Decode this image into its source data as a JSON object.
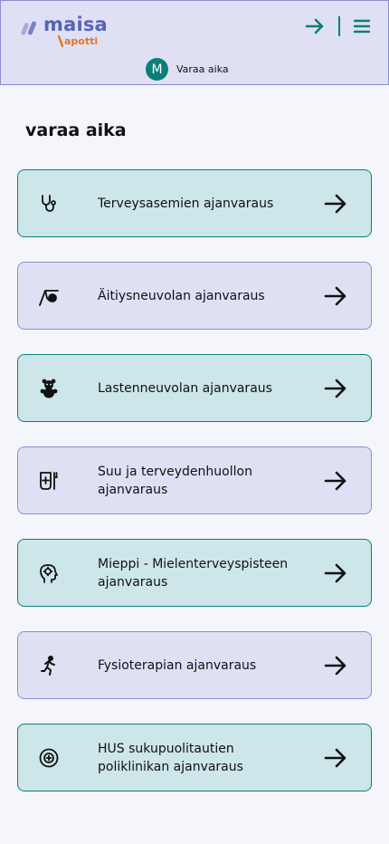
{
  "header": {
    "logo_text": "maisa",
    "logo_subtext": "apotti",
    "login_icon": "login-arrow-icon",
    "menu_icon": "hamburger-menu-icon",
    "user": {
      "initial": "M",
      "label": "Varaa aika"
    }
  },
  "colors": {
    "teal": "#0a7f7a",
    "lavender": "#5a63b8",
    "orange": "#e8731f"
  },
  "page": {
    "title": "varaa aika"
  },
  "cards": [
    {
      "label": "Terveysasemien ajanvaraus",
      "icon": "stethoscope-icon",
      "variant": "teal"
    },
    {
      "label": "Äitiysneuvolan ajanvaraus",
      "icon": "stork-baby-icon",
      "variant": "lavender"
    },
    {
      "label": "Lastenneuvolan ajanvaraus",
      "icon": "teddy-bear-icon",
      "variant": "teal"
    },
    {
      "label": "Suu ja terveydenhuollon ajanvaraus",
      "icon": "toothpaste-brush-icon",
      "variant": "lavender"
    },
    {
      "label": "Mieppi - Mielenterveyspisteen ajanvaraus",
      "icon": "head-brain-icon",
      "variant": "teal"
    },
    {
      "label": "Fysioterapian ajanvaraus",
      "icon": "running-person-icon",
      "variant": "lavender"
    },
    {
      "label": "HUS sukupuolitautien poliklinikan ajanvaraus",
      "icon": "circle-plus-icon",
      "variant": "teal"
    }
  ]
}
